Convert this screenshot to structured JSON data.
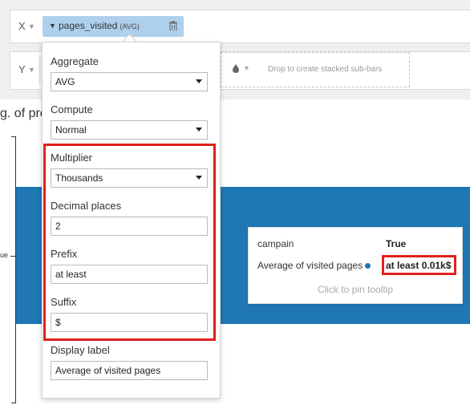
{
  "x_axis": {
    "letter": "X",
    "pill_name": "pages_visited",
    "pill_agg": "(AVG)"
  },
  "y_axis": {
    "letter": "Y",
    "drop_hint": "Drop to create stacked sub-bars"
  },
  "chart": {
    "title_partial": "g. of pre",
    "category_label": "ue"
  },
  "chart_data": {
    "type": "bar",
    "categories": [
      "True"
    ],
    "values": [
      0.01
    ]
  },
  "tooltip": {
    "row1_key": "campain",
    "row1_value": "True",
    "row2_key": "Average of visited pages",
    "row2_value": "at least 0.01k$",
    "pin_hint": "Click to pin tooltip",
    "series_color": "#1f77b4"
  },
  "panel": {
    "aggregate_label": "Aggregate",
    "aggregate_value": "AVG",
    "compute_label": "Compute",
    "compute_value": "Normal",
    "multiplier_label": "Multiplier",
    "multiplier_value": "Thousands",
    "decimal_label": "Decimal places",
    "decimal_value": "2",
    "prefix_label": "Prefix",
    "prefix_value": "at least",
    "suffix_label": "Suffix",
    "suffix_value": "$",
    "display_label_label": "Display label",
    "display_label_value": "Average of visited pages"
  },
  "colors": {
    "bar": "#1f77b4",
    "highlight": "#e0201c",
    "pill": "#aed0ec"
  }
}
